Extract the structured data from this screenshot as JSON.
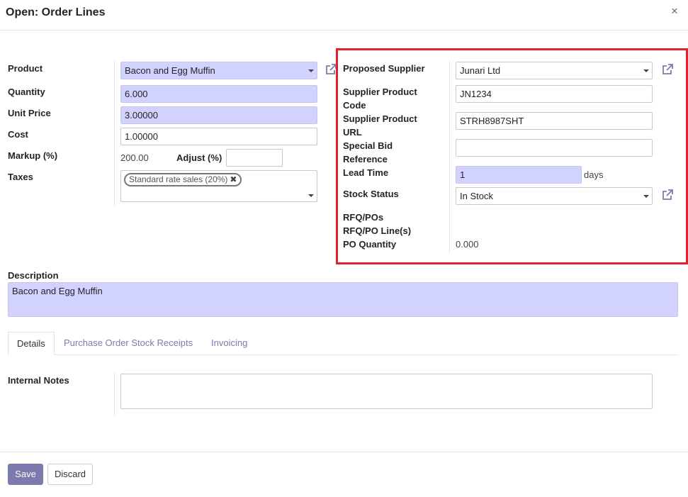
{
  "dialog": {
    "title": "Open: Order Lines",
    "close_glyph": "×"
  },
  "left": {
    "product": {
      "label": "Product",
      "value": "Bacon and Egg Muffin"
    },
    "quantity": {
      "label": "Quantity",
      "value": "6.000"
    },
    "unit_price": {
      "label": "Unit Price",
      "value": "3.00000"
    },
    "cost": {
      "label": "Cost",
      "value": "1.00000"
    },
    "markup": {
      "label": "Markup (%)",
      "value": "200.00"
    },
    "adjust": {
      "label": "Adjust (%)",
      "value": ""
    },
    "taxes": {
      "label": "Taxes",
      "tags": [
        "Standard rate sales (20%)"
      ]
    }
  },
  "right": {
    "proposed_supplier": {
      "label": "Proposed Supplier",
      "value": "Junari Ltd"
    },
    "supplier_product_code": {
      "label_line1": "Supplier Product",
      "label_line2": "Code",
      "value": "JN1234"
    },
    "supplier_product_url": {
      "label_line1": "Supplier Product",
      "label_line2": "URL",
      "value": "STRH8987SHT"
    },
    "special_bid_reference": {
      "label_line1": "Special Bid",
      "label_line2": "Reference",
      "value": ""
    },
    "lead_time": {
      "label": "Lead Time",
      "value": "1",
      "unit": "days"
    },
    "stock_status": {
      "label": "Stock Status",
      "value": "In Stock"
    },
    "rfq_pos": {
      "label": "RFQ/POs"
    },
    "rfq_po_lines": {
      "label": "RFQ/PO Line(s)"
    },
    "po_quantity": {
      "label": "PO Quantity",
      "value": "0.000"
    }
  },
  "description": {
    "label": "Description",
    "value": "Bacon and Egg Muffin"
  },
  "tabs": [
    {
      "label": "Details",
      "active": true
    },
    {
      "label": "Purchase Order Stock Receipts",
      "active": false
    },
    {
      "label": "Invoicing",
      "active": false
    }
  ],
  "details": {
    "internal_notes_label": "Internal Notes",
    "internal_notes_value": ""
  },
  "footer": {
    "save_label": "Save",
    "discard_label": "Discard"
  },
  "colors": {
    "accent": "#7c7bad",
    "required_bg": "#d2d2ff",
    "highlight_border": "#e0242f"
  },
  "icons": {
    "external_link": "external-link-icon",
    "dropdown": "caret-down-icon",
    "tag_remove": "remove-tag-icon"
  }
}
